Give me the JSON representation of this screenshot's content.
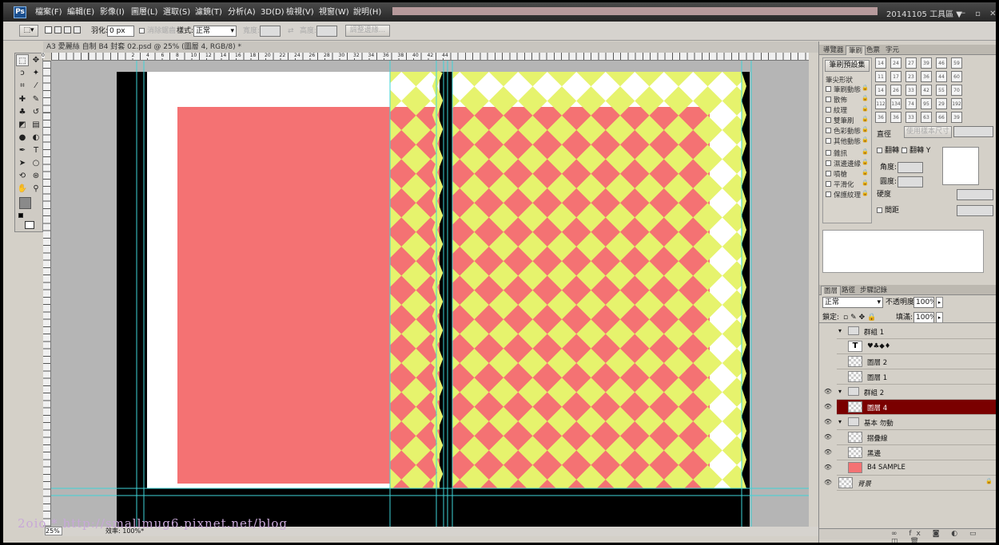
{
  "app": {
    "logo": "Ps",
    "menu": [
      "檔案(F)",
      "編輯(E)",
      "影像(I)",
      "圖層(L)",
      "選取(S)",
      "濾鏡(T)",
      "分析(A)",
      "3D(D)",
      "檢視(V)",
      "視窗(W)",
      "說明(H)"
    ],
    "workspace": "20141105 工具區",
    "workspace_caret": "▼",
    "window_buttons": "－ ▫ ✕"
  },
  "options": {
    "feather_label": "羽化:",
    "feather_value": "0 px",
    "antialias_label": "消除鋸齒",
    "style_label": "樣式:",
    "style_value": "正常",
    "width_label": "寬度:",
    "height_label": "高度:",
    "refine_button": "調整邊緣..."
  },
  "document": {
    "tab_title": "A3 愛麗絲 自制 B4 封套 02.psd @ 25% (圖層 4, RGB/8) *",
    "zoom": "25%",
    "efficiency": "效率: 100%*",
    "ruler_labels": [
      "0",
      "2",
      "4",
      "6",
      "8",
      "10",
      "12",
      "14",
      "16",
      "18",
      "20",
      "22",
      "24",
      "26",
      "28",
      "30",
      "32",
      "34",
      "36",
      "38",
      "40",
      "42",
      "44"
    ]
  },
  "watermark": "2oio * http://smallmug6.pixnet.net/blog",
  "brush_panel": {
    "tabs": [
      "導覽器",
      "筆刷",
      "色票",
      "字元"
    ],
    "preset_button": "筆刷預設集",
    "tip_shape": "筆尖形狀",
    "options": [
      "筆刷動態",
      "散佈",
      "紋理",
      "雙筆刷",
      "色彩動態",
      "其他動態",
      "雜訊",
      "濕邊邊緣",
      "噴槍",
      "平滑化",
      "保護紋理"
    ],
    "size_label": "直徑",
    "use_sample_button": "使用樣本尺寸",
    "flip_x": "翻轉 X",
    "flip_y": "翻轉 Y",
    "angle_label": "角度:",
    "roundness_label": "圓度:",
    "hardness_label": "硬度",
    "spacing_label": "間距",
    "sizes": [
      "14",
      "24",
      "27",
      "39",
      "46",
      "59",
      "11",
      "17",
      "23",
      "36",
      "44",
      "60",
      "14",
      "26",
      "33",
      "42",
      "55",
      "70",
      "112",
      "134",
      "74",
      "95",
      "29",
      "192",
      "36",
      "36",
      "33",
      "63",
      "66",
      "39"
    ]
  },
  "layers_panel": {
    "tabs": [
      "圖層",
      "路徑",
      "步驟記錄"
    ],
    "blend_mode": "正常",
    "opacity_label": "不透明度:",
    "opacity_value": "100%",
    "lock_label": "鎖定:",
    "fill_label": "填滿:",
    "fill_value": "100%",
    "layers": [
      {
        "name": "群組 1",
        "type": "group"
      },
      {
        "name": "♥♣◆♦",
        "type": "text",
        "thumb": "T"
      },
      {
        "name": "圖層 2",
        "type": "layer"
      },
      {
        "name": "圖層 1",
        "type": "layer"
      },
      {
        "name": "群組 2",
        "type": "group"
      },
      {
        "name": "圖層 4",
        "type": "layer",
        "selected": true
      },
      {
        "name": "基本 勿動",
        "type": "group"
      },
      {
        "name": "摺疊線",
        "type": "layer"
      },
      {
        "name": "黑邊",
        "type": "layer"
      },
      {
        "name": "B4 SAMPLE",
        "type": "layer"
      },
      {
        "name": "背景",
        "type": "background"
      }
    ]
  },
  "colors": {
    "salmon": "#f47273",
    "yellow": "#e6f36d",
    "guide": "#3ed4d8",
    "selected_layer": "#7a0000"
  }
}
